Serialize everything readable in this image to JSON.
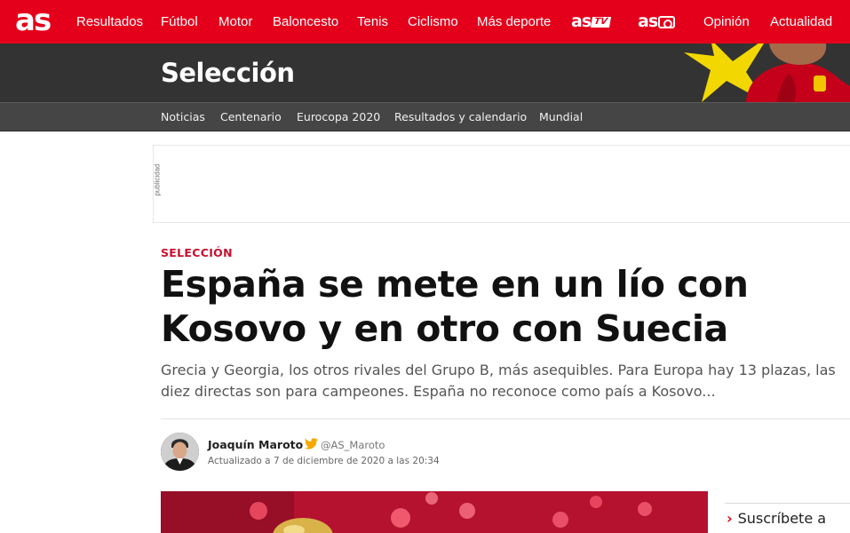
{
  "topnav": {
    "logo": "as",
    "items": [
      "Resultados",
      "Fútbol",
      "Motor",
      "Baloncesto",
      "Tenis",
      "Ciclismo",
      "Más deporte"
    ],
    "astv": {
      "text": "as",
      "badge": "TV"
    },
    "asfoto": {
      "text": "as"
    },
    "items_right": [
      "Opinión",
      "Actualidad"
    ]
  },
  "section": {
    "title": "Selección"
  },
  "subnav": {
    "items": [
      "Noticias",
      "Centenario",
      "Eurocopa 2020",
      "Resultados y calendario",
      "Mundial"
    ]
  },
  "ad": {
    "label": "publicidad"
  },
  "article": {
    "kicker": "SELECCIÓN",
    "headline_line1": "España se mete en un lío con",
    "headline_line2": "Kosovo y en otro con Suecia",
    "summary": "Grecia y Georgia, los otros rivales del Grupo B, más asequibles. Para Europa hay 13 plazas, las diez directas son para campeones. España no reconoce como país a Kosovo...",
    "author": "Joaquín Maroto",
    "twitter_handle": "@AS_Maroto",
    "updated": "Actualizado a 7 de diciembre de 2020 a las 20:34"
  },
  "sidebar": {
    "subscribe": "Suscríbete a"
  },
  "colors": {
    "brand_red": "#e4001b",
    "section_bg": "#333333",
    "subnav_bg": "#454545",
    "kicker": "#c8102e"
  }
}
